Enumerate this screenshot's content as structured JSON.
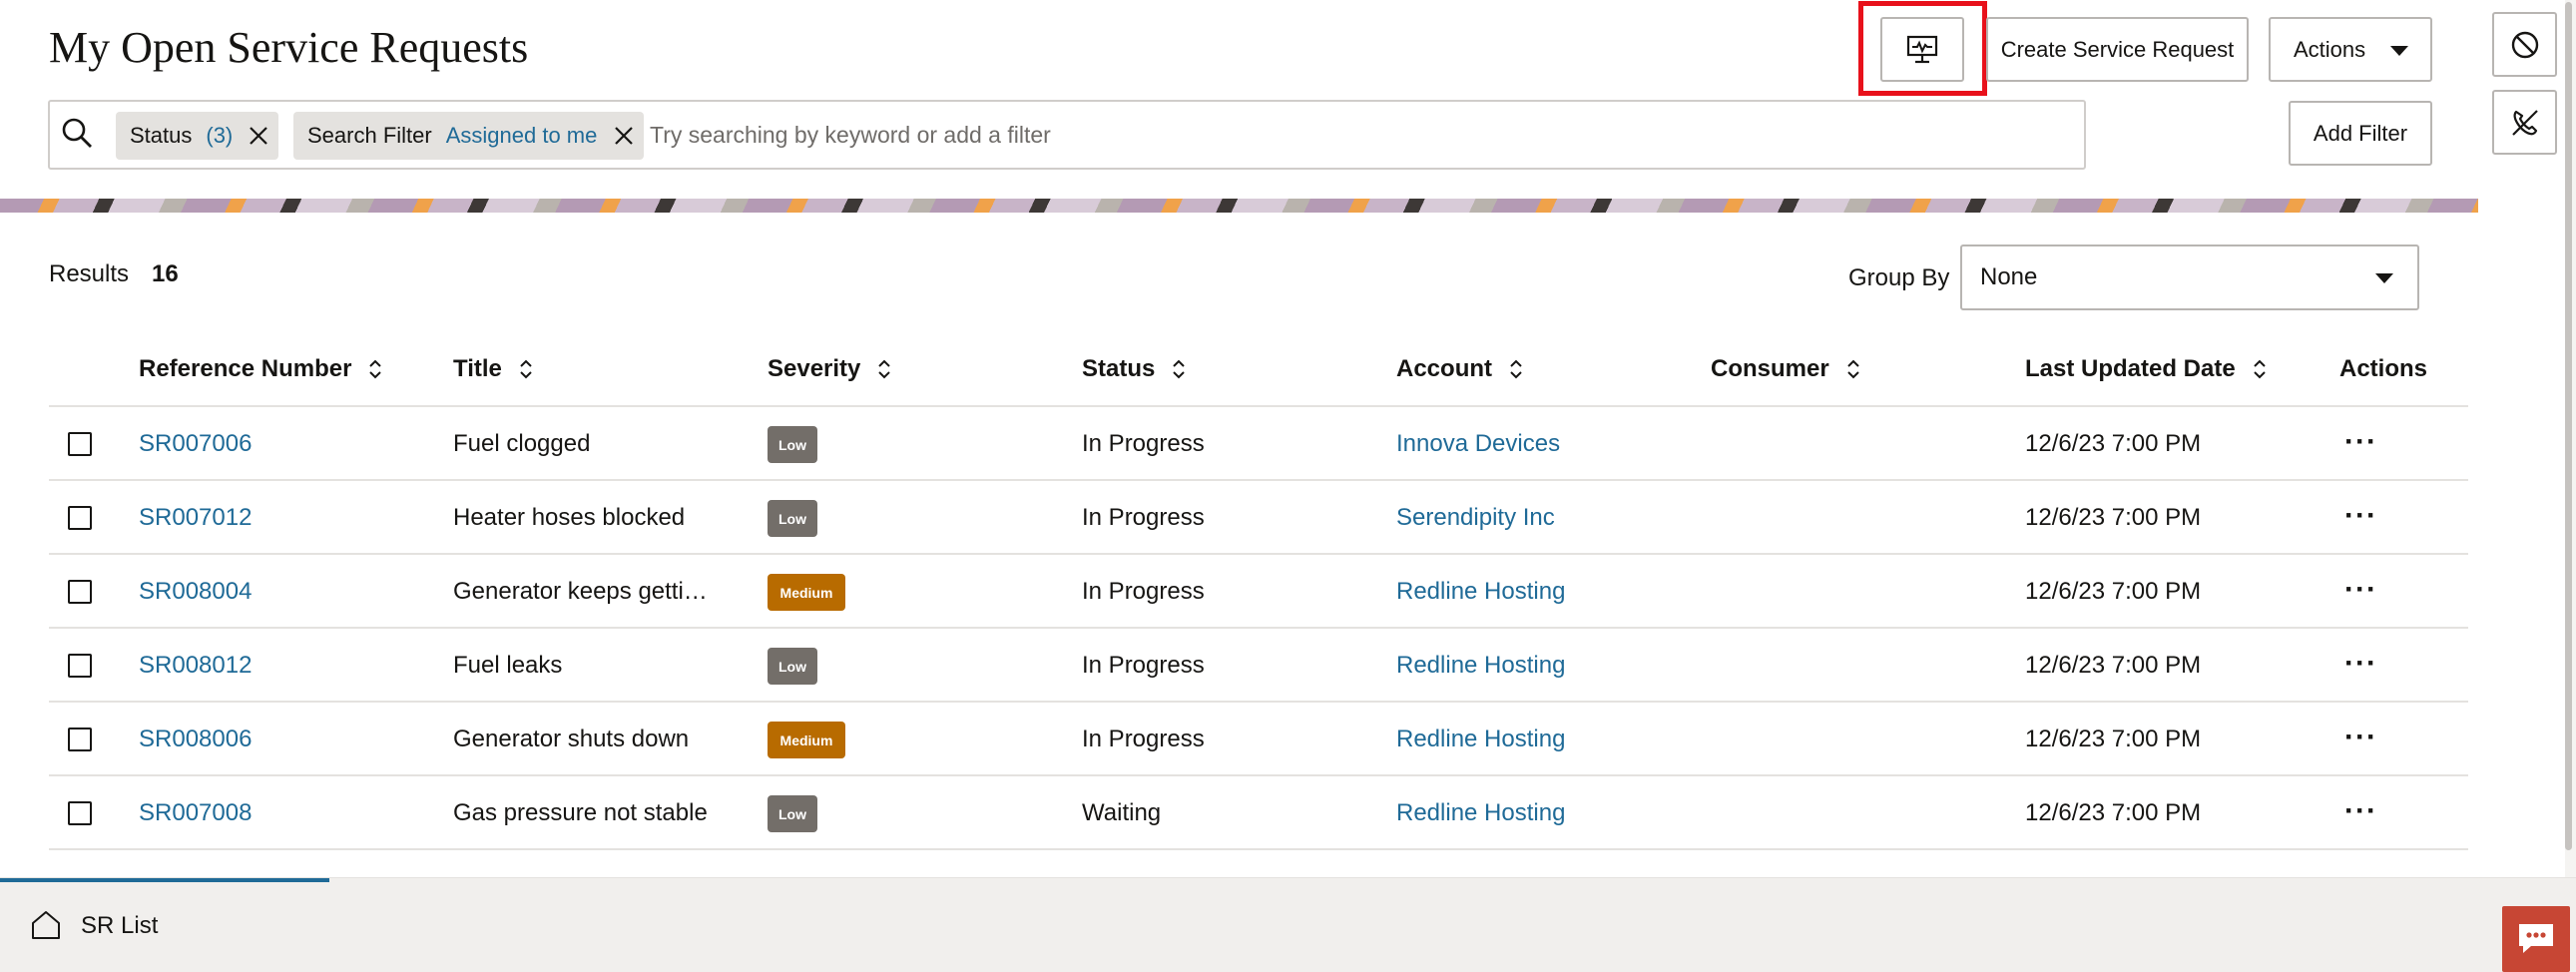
{
  "page": {
    "title": "My Open Service Requests"
  },
  "toolbar": {
    "monitor_icon": "monitor-pulse-icon",
    "create_label": "Create Service Request",
    "actions_label": "Actions",
    "add_filter_label": "Add Filter"
  },
  "side_panel": {
    "icons": [
      "ban-icon",
      "phone-off-icon"
    ]
  },
  "search": {
    "placeholder": "Try searching by keyword or add a filter",
    "chips": [
      {
        "label": "Status",
        "value": "(3)"
      },
      {
        "label": "Search Filter",
        "value": "Assigned to me"
      }
    ]
  },
  "results": {
    "label": "Results",
    "count": "16"
  },
  "group_by": {
    "label": "Group By",
    "selected": "None"
  },
  "table": {
    "columns": [
      "Reference Number",
      "Title",
      "Severity",
      "Status",
      "Account",
      "Consumer",
      "Last Updated Date",
      "Actions"
    ],
    "rows": [
      {
        "ref": "SR007006",
        "title": "Fuel clogged",
        "severity": "Low",
        "status": "In Progress",
        "account": "Innova Devices",
        "consumer": "",
        "updated": "12/6/23 7:00 PM",
        "actions": "···"
      },
      {
        "ref": "SR007012",
        "title": "Heater hoses blocked",
        "severity": "Low",
        "status": "In Progress",
        "account": "Serendipity Inc",
        "consumer": "",
        "updated": "12/6/23 7:00 PM",
        "actions": "···"
      },
      {
        "ref": "SR008004",
        "title": "Generator keeps getti…",
        "severity": "Medium",
        "status": "In Progress",
        "account": "Redline Hosting",
        "consumer": "",
        "updated": "12/6/23 7:00 PM",
        "actions": "···"
      },
      {
        "ref": "SR008012",
        "title": "Fuel leaks",
        "severity": "Low",
        "status": "In Progress",
        "account": "Redline Hosting",
        "consumer": "",
        "updated": "12/6/23 7:00 PM",
        "actions": "···"
      },
      {
        "ref": "SR008006",
        "title": "Generator shuts down",
        "severity": "Medium",
        "status": "In Progress",
        "account": "Redline Hosting",
        "consumer": "",
        "updated": "12/6/23 7:00 PM",
        "actions": "···"
      },
      {
        "ref": "SR007008",
        "title": "Gas pressure not stable",
        "severity": "Low",
        "status": "Waiting",
        "account": "Redline Hosting",
        "consumer": "",
        "updated": "12/6/23 7:00 PM",
        "actions": "···"
      }
    ]
  },
  "footer": {
    "tab_label": "SR List",
    "home_icon": "home-icon",
    "chat_icon": "chat-icon"
  },
  "colors": {
    "link": "#1f6a97",
    "low_badge": "#736e69",
    "medium_badge": "#b86b00",
    "highlight": "#e8111b",
    "chat": "#c74634"
  }
}
